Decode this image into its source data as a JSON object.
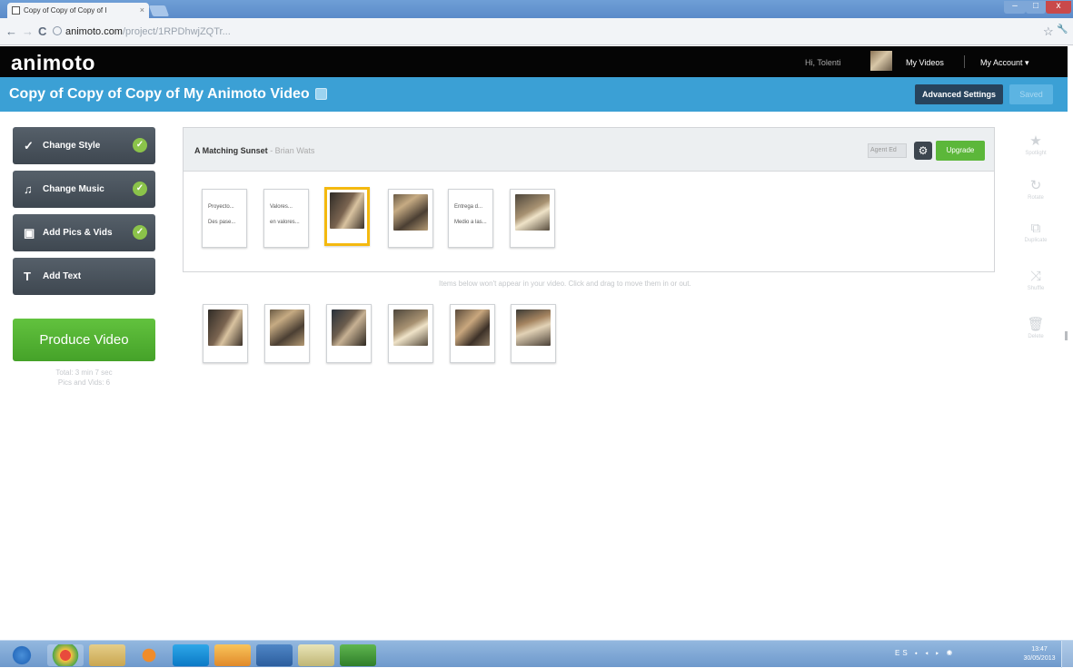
{
  "browser": {
    "tab_title": "Copy of Copy of Copy of I",
    "tab_close": "×",
    "url_host": "animoto.com",
    "url_path": "/project/1RPDhwjZQTr...",
    "nav_back": "←",
    "nav_forward": "→",
    "nav_reload": "C",
    "star": "☆",
    "wrench": "🔧"
  },
  "header": {
    "logo": "animoto",
    "user_name": "Hi, Tolenti",
    "my_videos": "My Videos",
    "my_account": "My Account ▾"
  },
  "project": {
    "title": "Copy of Copy of Copy of My Animoto Video",
    "advanced_settings": "Advanced Settings",
    "save": "Saved"
  },
  "sidebar": {
    "steps": [
      {
        "label": "Change Style",
        "icon": "brush-icon",
        "glyph": "✓",
        "done": true
      },
      {
        "label": "Change Music",
        "icon": "music-note-icon",
        "glyph": "♫",
        "done": true
      },
      {
        "label": "Add Pics & Vids",
        "icon": "image-icon",
        "glyph": "▣",
        "done": true
      },
      {
        "label": "Add Text",
        "icon": "text-icon",
        "glyph": "T",
        "done": false
      }
    ],
    "produce_label": "Produce Video",
    "produce_note_1": "Total: 3 min 7 sec",
    "produce_note_2": "Pics and Vids: 6"
  },
  "song": {
    "title": "A Matching Sunset",
    "artist": "- Brian Wats",
    "input": "Agent Ed",
    "upgrade": "Upgrade"
  },
  "storyboard": {
    "cards": [
      {
        "type": "text",
        "line1": "Proyecto...",
        "line2": "Des pase..."
      },
      {
        "type": "text",
        "line1": "Valores...",
        "line2": "en valores..."
      },
      {
        "type": "photo",
        "selected": true
      },
      {
        "type": "photo",
        "selected": false
      },
      {
        "type": "text",
        "line1": "Entrega d...",
        "line2": "Medio a las..."
      },
      {
        "type": "photo",
        "selected": false
      }
    ],
    "hint": "Items below won't appear in your video. Click and drag to move them in or out.",
    "unused_photos": 6
  },
  "tools": [
    {
      "label": "Spotlight",
      "icon": "star-icon",
      "glyph": "★"
    },
    {
      "label": "Rotate",
      "icon": "rotate-icon",
      "glyph": "↻"
    },
    {
      "label": "Duplicate",
      "icon": "duplicate-icon",
      "glyph": "⧉"
    },
    {
      "label": "Shuffle",
      "icon": "shuffle-icon",
      "glyph": "⤨"
    },
    {
      "label": "Delete",
      "icon": "trash-icon",
      "glyph": "🗑"
    }
  ],
  "taskbar": {
    "tray": "ES ⬩ ◂ ▸ ◉",
    "time": "13:47",
    "date": "30/05/2013"
  },
  "colors": {
    "brand_black": "#050505",
    "project_bar_blue": "#3ba0d5",
    "produce_green": "#4caf2e",
    "selected_card": "#f4b90f",
    "step_bg": "#4a535c"
  }
}
